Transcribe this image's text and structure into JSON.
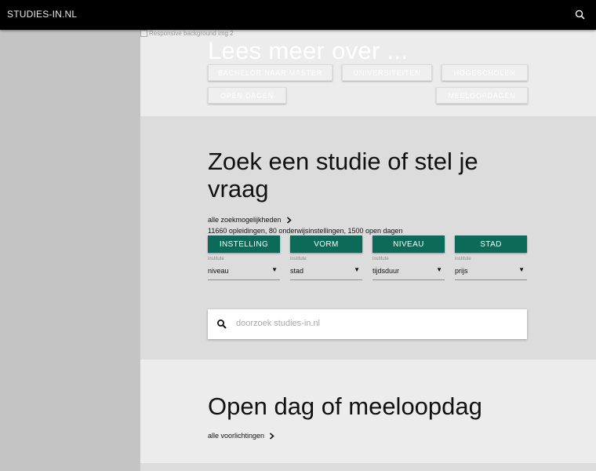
{
  "header": {
    "logo": "STUDIES-IN.NL",
    "search_icon": "search-icon"
  },
  "hero": {
    "image_alt": "Responsive background img 2",
    "title": "Lees meer over ...",
    "links": [
      "BACHELOR NAAR MASTER",
      "UNIVERSITEITEN",
      "HOGESCHOLEN",
      "OPEN DAGEN",
      "MEELOOPDAGEN"
    ]
  },
  "search_section": {
    "title": "Zoek een studie of stel je vraag",
    "all_options_link": "alle zoekmogelijkheden",
    "stats": "11660 opleidingen, 80 onderwijsinstellingen, 1500 open dagen",
    "filter_buttons": [
      "INSTELLING",
      "VORM",
      "NIVEAU",
      "STAD"
    ],
    "filter_sublabels": [
      "institute",
      "institute",
      "institute",
      "institute"
    ],
    "selects": [
      "niveau",
      "stad",
      "tijdsduur",
      "prijs"
    ],
    "search_placeholder": "doorzoek studies-in.nl"
  },
  "open_section": {
    "title": "Open dag of meeloopdag",
    "all_link": "alle voorlichtingen"
  },
  "colors": {
    "topbar": "#000000",
    "accent_green": "#0b6b58",
    "sidebar": "#c4c4c4"
  }
}
